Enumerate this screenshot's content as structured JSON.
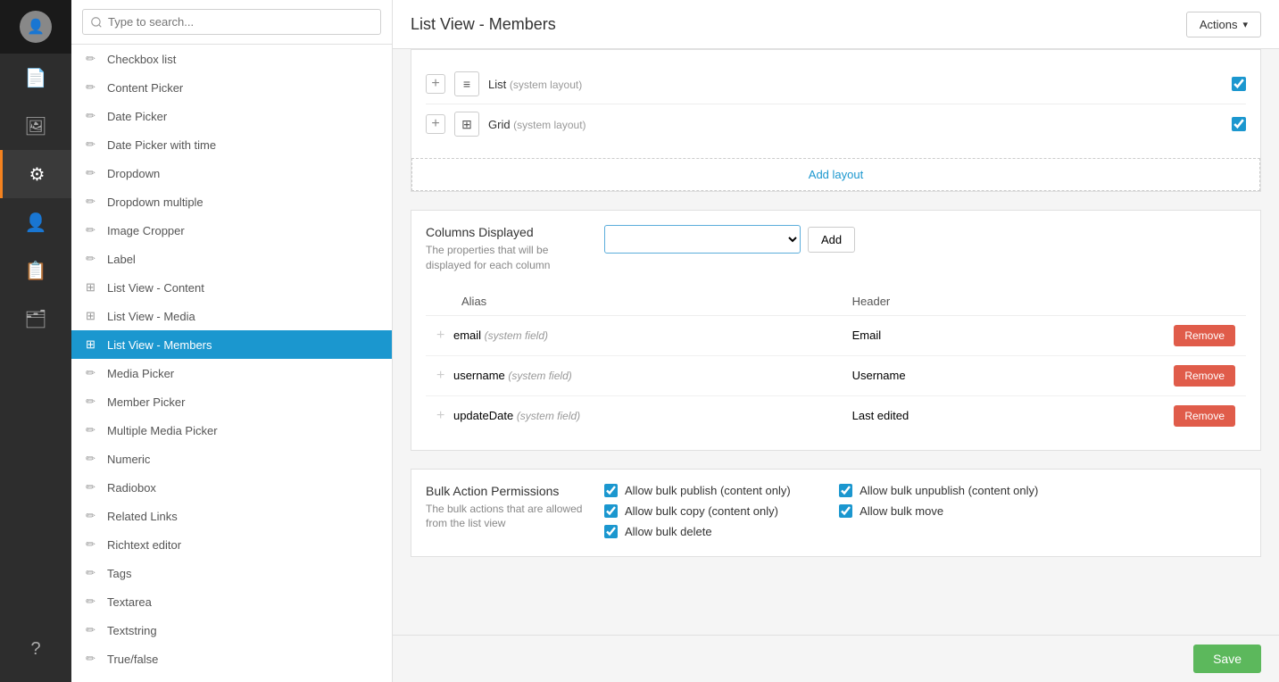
{
  "iconBar": {
    "items": [
      {
        "id": "content",
        "icon": "📄",
        "active": false
      },
      {
        "id": "media",
        "icon": "🖼",
        "active": false
      },
      {
        "id": "settings",
        "icon": "⚙",
        "active": true
      },
      {
        "id": "members",
        "icon": "👤",
        "active": false
      },
      {
        "id": "contacts",
        "icon": "📋",
        "active": false
      },
      {
        "id": "list",
        "icon": "🗂",
        "active": false
      }
    ],
    "bottomItem": {
      "id": "help",
      "icon": "?"
    }
  },
  "sidebar": {
    "searchPlaceholder": "Type to search...",
    "items": [
      {
        "id": "checkbox-list",
        "label": "Checkbox list",
        "type": "pen"
      },
      {
        "id": "content-picker",
        "label": "Content Picker",
        "type": "pen"
      },
      {
        "id": "date-picker",
        "label": "Date Picker",
        "type": "pen"
      },
      {
        "id": "date-picker-time",
        "label": "Date Picker with time",
        "type": "pen"
      },
      {
        "id": "dropdown",
        "label": "Dropdown",
        "type": "pen"
      },
      {
        "id": "dropdown-multiple",
        "label": "Dropdown multiple",
        "type": "pen"
      },
      {
        "id": "image-cropper",
        "label": "Image Cropper",
        "type": "pen"
      },
      {
        "id": "label",
        "label": "Label",
        "type": "pen"
      },
      {
        "id": "list-view-content",
        "label": "List View - Content",
        "type": "grid"
      },
      {
        "id": "list-view-media",
        "label": "List View - Media",
        "type": "grid"
      },
      {
        "id": "list-view-members",
        "label": "List View - Members",
        "type": "grid",
        "active": true
      },
      {
        "id": "media-picker",
        "label": "Media Picker",
        "type": "pen"
      },
      {
        "id": "member-picker",
        "label": "Member Picker",
        "type": "pen"
      },
      {
        "id": "multiple-media-picker",
        "label": "Multiple Media Picker",
        "type": "pen"
      },
      {
        "id": "numeric",
        "label": "Numeric",
        "type": "pen"
      },
      {
        "id": "radiobox",
        "label": "Radiobox",
        "type": "pen"
      },
      {
        "id": "related-links",
        "label": "Related Links",
        "type": "pen"
      },
      {
        "id": "richtext-editor",
        "label": "Richtext editor",
        "type": "pen"
      },
      {
        "id": "tags",
        "label": "Tags",
        "type": "pen"
      },
      {
        "id": "textarea",
        "label": "Textarea",
        "type": "pen"
      },
      {
        "id": "textstring",
        "label": "Textstring",
        "type": "pen"
      },
      {
        "id": "true-false",
        "label": "True/false",
        "type": "pen"
      }
    ]
  },
  "header": {
    "title": "List View - Members",
    "actionsLabel": "Actions"
  },
  "layouts": [
    {
      "id": "list",
      "icon": "≡",
      "name": "List",
      "systemLayout": true,
      "checked": true
    },
    {
      "id": "grid",
      "icon": "⊞",
      "name": "Grid",
      "systemLayout": true,
      "checked": true
    }
  ],
  "addLayoutLabel": "Add layout",
  "columnsDisplayed": {
    "label": "Columns Displayed",
    "description": "The properties that will be displayed for each column",
    "addButtonLabel": "Add",
    "tableHeaders": [
      "Alias",
      "Header"
    ],
    "rows": [
      {
        "alias": "email",
        "systemField": true,
        "header": "Email"
      },
      {
        "alias": "username",
        "systemField": true,
        "header": "Username"
      },
      {
        "alias": "updateDate",
        "systemField": true,
        "header": "Last edited"
      }
    ],
    "removeLabel": "Remove",
    "systemFieldLabel": "(system field)"
  },
  "bulkActions": {
    "label": "Bulk Action Permissions",
    "description": "The bulk actions that are allowed from the list view",
    "options": [
      {
        "id": "bulk-publish",
        "label": "Allow bulk publish (content only)",
        "checked": true
      },
      {
        "id": "bulk-unpublish",
        "label": "Allow bulk unpublish (content only)",
        "checked": true
      },
      {
        "id": "bulk-copy",
        "label": "Allow bulk copy (content only)",
        "checked": true
      },
      {
        "id": "bulk-move",
        "label": "Allow bulk move",
        "checked": true
      },
      {
        "id": "bulk-delete",
        "label": "Allow bulk delete",
        "checked": true
      }
    ]
  },
  "saveLabel": "Save"
}
